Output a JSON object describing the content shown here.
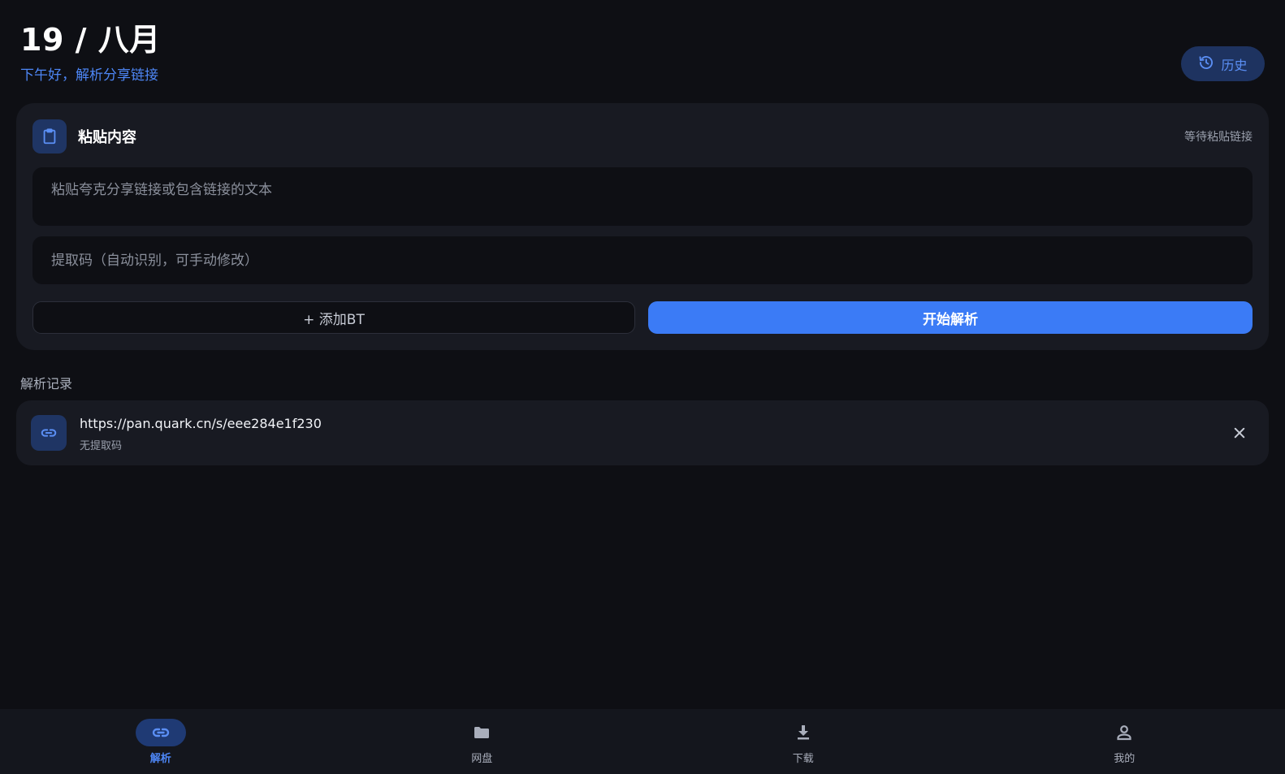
{
  "header": {
    "date_title": "19 / 八月",
    "greeting": "下午好，解析分享链接",
    "history_label": "历史"
  },
  "paste_card": {
    "title": "粘贴内容",
    "status": "等待粘贴链接",
    "link_placeholder": "粘贴夸克分享链接或包含链接的文本",
    "link_value": "",
    "code_placeholder": "提取码（自动识别，可手动修改）",
    "code_value": "",
    "add_bt_label": "+ 添加BT",
    "start_label": "开始解析"
  },
  "records": {
    "section_label": "解析记录",
    "items": [
      {
        "url": "https://pan.quark.cn/s/eee284e1f230",
        "code": "无提取码"
      }
    ]
  },
  "bottom_nav": {
    "items": [
      {
        "label": "解析",
        "icon": "link-icon",
        "active": true
      },
      {
        "label": "网盘",
        "icon": "folder-icon",
        "active": false
      },
      {
        "label": "下载",
        "icon": "download-icon",
        "active": false
      },
      {
        "label": "我的",
        "icon": "user-icon",
        "active": false
      }
    ]
  },
  "colors": {
    "background": "#0e0f14",
    "card": "#181a22",
    "accent": "#3b7bf6",
    "accent_text": "#4d86f5",
    "icon_bg": "#1f3564"
  }
}
